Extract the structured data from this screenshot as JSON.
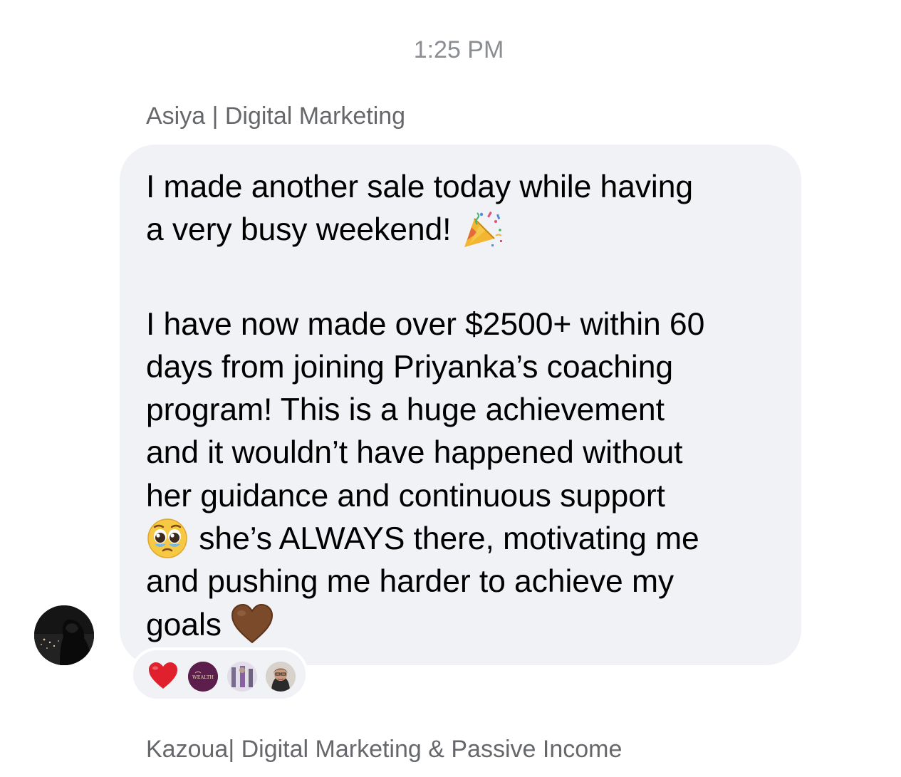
{
  "timestamp": "1:25 PM",
  "message": {
    "sender": "Asiya | Digital Marketing",
    "paragraph1": [
      "I made another sale today while having",
      "a very busy weekend!"
    ],
    "paragraph2": [
      "I have now made over $2500+ within 60",
      "days from joining Priyanka’s coaching",
      "program! This is a huge achievement",
      "and it wouldn’t have happened without",
      "her guidance and continuous support",
      "she’s ALWAYS there, motivating me",
      "and pushing me harder to achieve my",
      "goals"
    ],
    "emojis": {
      "after_paragraph1": "party-popper-icon",
      "before_line6": "pleading-face-icon",
      "after_goals": "brown-heart-icon"
    }
  },
  "reactions": [
    {
      "icon": "red-heart-icon"
    },
    {
      "icon": "wealth-logo-avatar",
      "text": "WEALTH"
    },
    {
      "icon": "user-avatar"
    },
    {
      "icon": "user-avatar"
    }
  ],
  "next_message": {
    "sender": "Kazoua| Digital Marketing & Passive Income"
  },
  "colors": {
    "bubble": "#f0f2f5",
    "meta_text": "#65676b",
    "heart": "#e0202c",
    "brown_heart": "#7a4a2a"
  }
}
